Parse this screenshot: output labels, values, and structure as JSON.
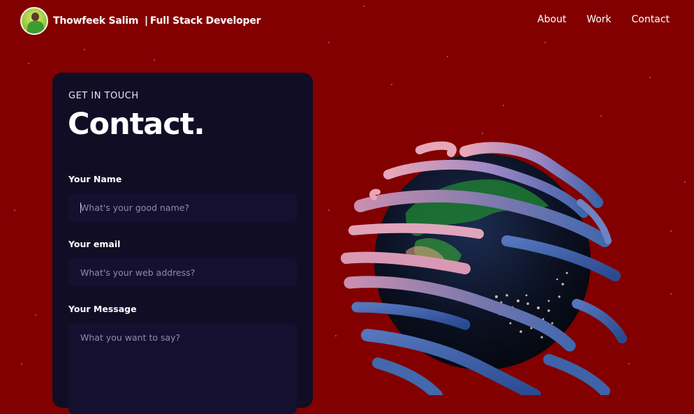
{
  "nav": {
    "brand_name": "Thowfeek Salim",
    "brand_separator": "|",
    "brand_role": "Full Stack Developer",
    "links": [
      "About",
      "Work",
      "Contact"
    ]
  },
  "contact": {
    "subtitle": "GET IN TOUCH",
    "title": "Contact.",
    "name_label": "Your Name",
    "name_placeholder": "What's your good name?",
    "email_label": "Your email",
    "email_placeholder": "What's your web address?",
    "message_label": "Your Message",
    "message_placeholder": "What you want to say?"
  },
  "colors": {
    "page_background": "#820000",
    "card_background": "#100d25",
    "field_background": "#151030",
    "placeholder_text": "#8f8ca6"
  },
  "icons": [
    "avatar-photo",
    "earth-globe"
  ]
}
